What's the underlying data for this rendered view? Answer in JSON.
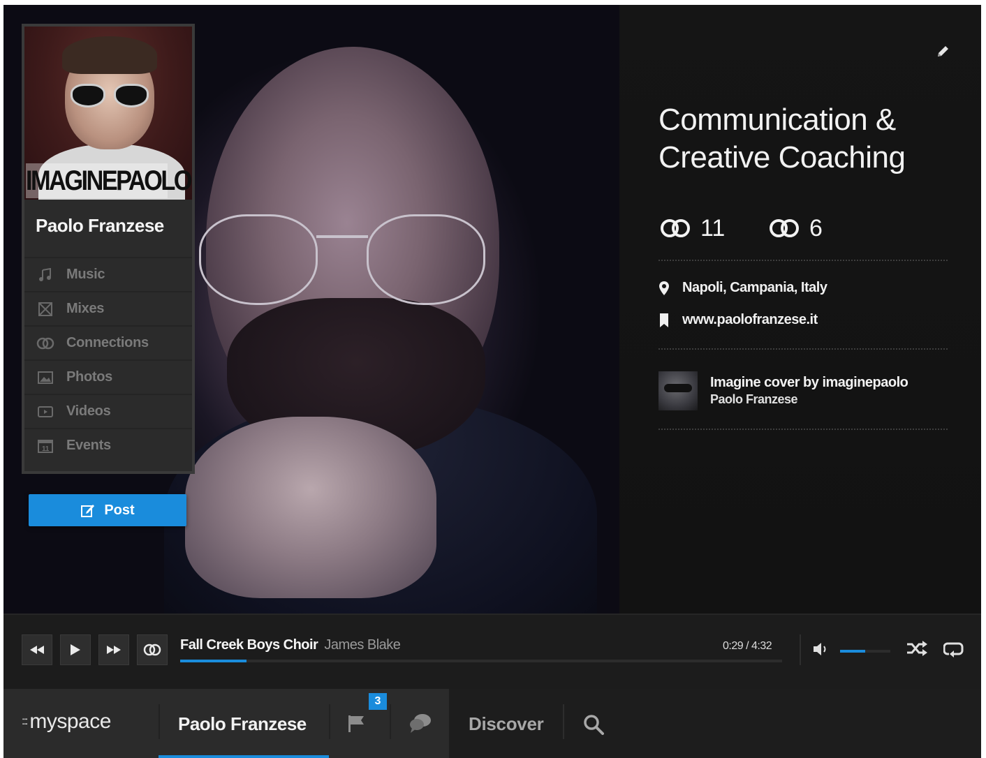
{
  "profile": {
    "avatar_logo_text": "IMAGINEPAOLO",
    "name": "Paolo Franzese",
    "nav_items": [
      {
        "label": "Music",
        "icon": "music-note-icon"
      },
      {
        "label": "Mixes",
        "icon": "mixes-icon"
      },
      {
        "label": "Connections",
        "icon": "connections-icon"
      },
      {
        "label": "Photos",
        "icon": "photo-icon"
      },
      {
        "label": "Videos",
        "icon": "video-icon"
      },
      {
        "label": "Events",
        "icon": "calendar-icon"
      }
    ],
    "events_icon_day": "11",
    "post_label": "Post"
  },
  "info": {
    "headline": "Communication & Creative Coaching",
    "stat_a": "11",
    "stat_b": "6",
    "location": "Napoli, Campania, Italy",
    "website": "www.paolofranzese.it",
    "cover_song_title": "Imagine cover by imaginepaolo",
    "cover_song_artist": "Paolo Franzese"
  },
  "player": {
    "track_title": "Fall Creek Boys Choir",
    "track_artist": "James Blake",
    "time": "0:29 / 4:32",
    "progress_percent": 11,
    "volume_percent": 50
  },
  "bottom_nav": {
    "logo_text": "myspace",
    "logo_grid": ":::",
    "user_tab": "Paolo Franzese",
    "notification_count": "3",
    "discover": "Discover"
  },
  "colors": {
    "accent": "#1a8cdc",
    "panel_bg": "#141414",
    "card_bg": "#2b2b2b"
  }
}
